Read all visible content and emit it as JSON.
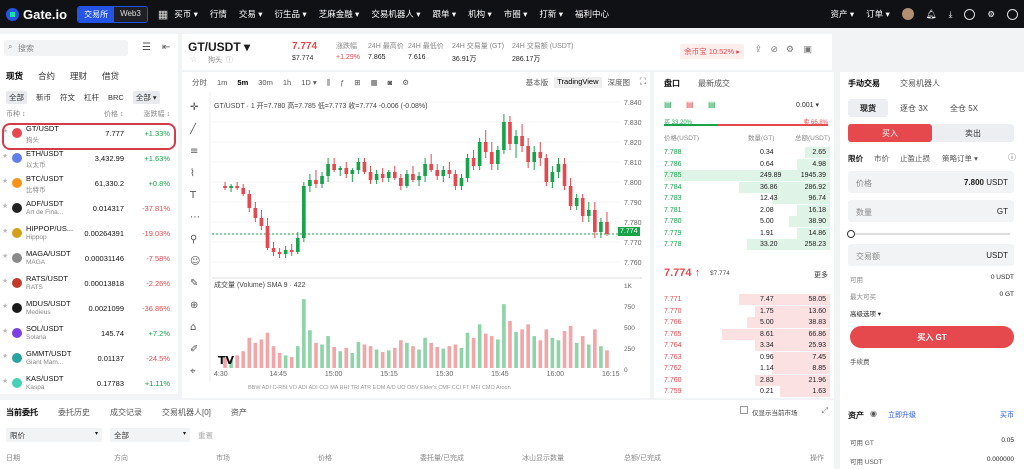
{
  "topbar": {
    "logo": "Gate.io",
    "mode_tabs": [
      "交易所",
      "Web3"
    ],
    "nav": [
      "买币 ▾",
      "行情",
      "交易 ▾",
      "衍生品 ▾",
      "芝麻金融 ▾",
      "交易机器人 ▾",
      "跟单 ▾",
      "机构 ▾",
      "市圈 ▾",
      "打新 ▾",
      "福利中心"
    ],
    "right": [
      "资产 ▾",
      "订单 ▾"
    ]
  },
  "left": {
    "search_placeholder": "搜索",
    "cats": [
      "现货",
      "合约",
      "理财",
      "借贷"
    ],
    "subcats": [
      "全部",
      "新币",
      "符文",
      "杠杆",
      "BRC",
      "全部 ▾"
    ],
    "col_pair": "币种 ↕",
    "col_price": "价格 ↕",
    "col_change": "涨跌幅 ↕",
    "rows": [
      {
        "pair": "GT/USDT",
        "sub": "狗头",
        "price": "7.777",
        "change": "+1.33%",
        "color": "#e5484d"
      },
      {
        "pair": "ETH/USDT",
        "sub": "以太币",
        "price": "3,432.99",
        "change": "+1.63%",
        "color": "#627eea"
      },
      {
        "pair": "BTC/USDT",
        "sub": "比特币",
        "price": "61,330.2",
        "change": "+0.8%",
        "color": "#f7931a"
      },
      {
        "pair": "ADF/USDT",
        "sub": "Art de Fina...",
        "price": "0.014317",
        "change": "-37.81%",
        "color": "#222222"
      },
      {
        "pair": "HIPPOP/US...",
        "sub": "Hippop",
        "price": "0.00264391",
        "change": "-19.03%",
        "color": "#d4a017"
      },
      {
        "pair": "MAGA/USDT",
        "sub": "MAGA",
        "price": "0.00031146",
        "change": "-7.58%",
        "color": "#8a8a8a"
      },
      {
        "pair": "RATS/USDT",
        "sub": "RATS",
        "price": "0.00013818",
        "change": "-2.26%",
        "color": "#c0392b"
      },
      {
        "pair": "MDUS/USDT",
        "sub": "Medieus",
        "price": "0.0021099",
        "change": "-36.86%",
        "color": "#1a1a1a"
      },
      {
        "pair": "SOL/USDT",
        "sub": "Solana",
        "price": "145.74",
        "change": "+7.2%",
        "color": "#7b3fe4"
      },
      {
        "pair": "GMMT/USDT",
        "sub": "Giant Mam...",
        "price": "0.01137",
        "change": "-24.5%",
        "color": "#2aa3a3"
      },
      {
        "pair": "KAS/USDT",
        "sub": "Kaspa",
        "price": "0.17783",
        "change": "+1.11%",
        "color": "#49d1b5"
      }
    ]
  },
  "header": {
    "pair": "GT/USDT ▾",
    "pair_sub": "狗头",
    "last_price": "7.774",
    "last_price_usd": "$7.774",
    "stats": [
      {
        "label": "涨跌幅",
        "value": "+1.29%"
      },
      {
        "label": "24H 最高价",
        "value": "7.865"
      },
      {
        "label": "24H 最低价",
        "value": "7.616"
      },
      {
        "label": "24H 交易量 (GT)",
        "value": "36.91万"
      },
      {
        "label": "24H 交易额 (USDT)",
        "value": "286.17万"
      }
    ],
    "yubi": "余币宝 10.52% ▸"
  },
  "chart": {
    "intervals": [
      "分时",
      "1m",
      "5m",
      "30m",
      "1h",
      "1D ▾"
    ],
    "views": [
      "基本版",
      "TradingView",
      "深度图"
    ],
    "ohlc": "GT/USDT · 1 开=7.780 高=7.785 低=7.773 收=7.774 -0.006 (-0.08%)",
    "volume_label": "成交量 (Volume) SMA 9 · 422",
    "price_tag": "7.774",
    "indicators": "BBW ADI C-RBI VO ADI ADI CCI MA RHI TRI ATR EOM A/D UO OBV Elder's CMF CCI FT MFI CMO Aroon",
    "chart_data": {
      "type": "candlestick",
      "title": "GT/USDT",
      "ylim": [
        7.755,
        7.845
      ],
      "yticks": [
        "7.840",
        "7.830",
        "7.820",
        "7.810",
        "7.800",
        "7.790",
        "7.780",
        "7.770",
        "7.760"
      ],
      "xticks": [
        "4:30",
        "14:45",
        "15:00",
        "15:15",
        "15:30",
        "15:45",
        "16:00",
        "16:15"
      ],
      "volume_ticks": [
        "1K",
        "750",
        "500",
        "250",
        "0"
      ],
      "volume_max": 1000,
      "candles": [
        {
          "o": 7.798,
          "h": 7.8,
          "l": 7.796,
          "c": 7.797,
          "v": 120
        },
        {
          "o": 7.797,
          "h": 7.799,
          "l": 7.795,
          "c": 7.798,
          "v": 90
        },
        {
          "o": 7.798,
          "h": 7.8,
          "l": 7.796,
          "c": 7.797,
          "v": 150
        },
        {
          "o": 7.797,
          "h": 7.799,
          "l": 7.793,
          "c": 7.794,
          "v": 200
        },
        {
          "o": 7.794,
          "h": 7.796,
          "l": 7.785,
          "c": 7.787,
          "v": 360
        },
        {
          "o": 7.787,
          "h": 7.79,
          "l": 7.78,
          "c": 7.782,
          "v": 300
        },
        {
          "o": 7.782,
          "h": 7.786,
          "l": 7.776,
          "c": 7.778,
          "v": 340
        },
        {
          "o": 7.778,
          "h": 7.782,
          "l": 7.766,
          "c": 7.767,
          "v": 420
        },
        {
          "o": 7.767,
          "h": 7.77,
          "l": 7.763,
          "c": 7.765,
          "v": 260
        },
        {
          "o": 7.765,
          "h": 7.767,
          "l": 7.762,
          "c": 7.764,
          "v": 180
        },
        {
          "o": 7.764,
          "h": 7.768,
          "l": 7.762,
          "c": 7.766,
          "v": 150
        },
        {
          "o": 7.766,
          "h": 7.769,
          "l": 7.763,
          "c": 7.765,
          "v": 130
        },
        {
          "o": 7.765,
          "h": 7.775,
          "l": 7.764,
          "c": 7.772,
          "v": 260
        },
        {
          "o": 7.772,
          "h": 7.8,
          "l": 7.77,
          "c": 7.798,
          "v": 820
        },
        {
          "o": 7.798,
          "h": 7.804,
          "l": 7.795,
          "c": 7.801,
          "v": 450
        },
        {
          "o": 7.801,
          "h": 7.806,
          "l": 7.797,
          "c": 7.799,
          "v": 300
        },
        {
          "o": 7.799,
          "h": 7.805,
          "l": 7.797,
          "c": 7.803,
          "v": 280
        },
        {
          "o": 7.803,
          "h": 7.812,
          "l": 7.8,
          "c": 7.809,
          "v": 380
        },
        {
          "o": 7.809,
          "h": 7.812,
          "l": 7.805,
          "c": 7.806,
          "v": 250
        },
        {
          "o": 7.806,
          "h": 7.808,
          "l": 7.803,
          "c": 7.807,
          "v": 200
        },
        {
          "o": 7.807,
          "h": 7.81,
          "l": 7.802,
          "c": 7.804,
          "v": 240
        },
        {
          "o": 7.804,
          "h": 7.807,
          "l": 7.8,
          "c": 7.806,
          "v": 180
        },
        {
          "o": 7.806,
          "h": 7.812,
          "l": 7.804,
          "c": 7.81,
          "v": 310
        },
        {
          "o": 7.81,
          "h": 7.812,
          "l": 7.804,
          "c": 7.805,
          "v": 280
        },
        {
          "o": 7.805,
          "h": 7.808,
          "l": 7.799,
          "c": 7.801,
          "v": 260
        },
        {
          "o": 7.801,
          "h": 7.806,
          "l": 7.799,
          "c": 7.804,
          "v": 220
        },
        {
          "o": 7.804,
          "h": 7.807,
          "l": 7.8,
          "c": 7.802,
          "v": 190
        },
        {
          "o": 7.802,
          "h": 7.806,
          "l": 7.8,
          "c": 7.805,
          "v": 210
        },
        {
          "o": 7.805,
          "h": 7.808,
          "l": 7.801,
          "c": 7.802,
          "v": 240
        },
        {
          "o": 7.802,
          "h": 7.804,
          "l": 7.796,
          "c": 7.798,
          "v": 330
        },
        {
          "o": 7.798,
          "h": 7.806,
          "l": 7.797,
          "c": 7.804,
          "v": 300
        },
        {
          "o": 7.804,
          "h": 7.808,
          "l": 7.8,
          "c": 7.801,
          "v": 260
        },
        {
          "o": 7.801,
          "h": 7.805,
          "l": 7.798,
          "c": 7.803,
          "v": 220
        },
        {
          "o": 7.803,
          "h": 7.812,
          "l": 7.8,
          "c": 7.809,
          "v": 360
        },
        {
          "o": 7.809,
          "h": 7.814,
          "l": 7.805,
          "c": 7.806,
          "v": 300
        },
        {
          "o": 7.806,
          "h": 7.809,
          "l": 7.801,
          "c": 7.803,
          "v": 250
        },
        {
          "o": 7.803,
          "h": 7.808,
          "l": 7.8,
          "c": 7.806,
          "v": 230
        },
        {
          "o": 7.806,
          "h": 7.81,
          "l": 7.802,
          "c": 7.804,
          "v": 260
        },
        {
          "o": 7.804,
          "h": 7.806,
          "l": 7.796,
          "c": 7.798,
          "v": 280
        },
        {
          "o": 7.798,
          "h": 7.804,
          "l": 7.796,
          "c": 7.802,
          "v": 240
        },
        {
          "o": 7.802,
          "h": 7.814,
          "l": 7.8,
          "c": 7.812,
          "v": 420
        },
        {
          "o": 7.812,
          "h": 7.816,
          "l": 7.806,
          "c": 7.808,
          "v": 360
        },
        {
          "o": 7.808,
          "h": 7.822,
          "l": 7.806,
          "c": 7.82,
          "v": 520
        },
        {
          "o": 7.82,
          "h": 7.826,
          "l": 7.812,
          "c": 7.815,
          "v": 410
        },
        {
          "o": 7.815,
          "h": 7.82,
          "l": 7.806,
          "c": 7.809,
          "v": 380
        },
        {
          "o": 7.809,
          "h": 7.818,
          "l": 7.806,
          "c": 7.816,
          "v": 340
        },
        {
          "o": 7.816,
          "h": 7.834,
          "l": 7.814,
          "c": 7.83,
          "v": 760
        },
        {
          "o": 7.83,
          "h": 7.833,
          "l": 7.816,
          "c": 7.819,
          "v": 560
        },
        {
          "o": 7.819,
          "h": 7.826,
          "l": 7.812,
          "c": 7.823,
          "v": 430
        },
        {
          "o": 7.823,
          "h": 7.829,
          "l": 7.815,
          "c": 7.818,
          "v": 460
        },
        {
          "o": 7.818,
          "h": 7.822,
          "l": 7.807,
          "c": 7.81,
          "v": 520
        },
        {
          "o": 7.81,
          "h": 7.818,
          "l": 7.806,
          "c": 7.815,
          "v": 380
        },
        {
          "o": 7.815,
          "h": 7.82,
          "l": 7.808,
          "c": 7.812,
          "v": 330
        },
        {
          "o": 7.812,
          "h": 7.814,
          "l": 7.798,
          "c": 7.8,
          "v": 460
        },
        {
          "o": 7.8,
          "h": 7.808,
          "l": 7.797,
          "c": 7.805,
          "v": 360
        },
        {
          "o": 7.805,
          "h": 7.812,
          "l": 7.802,
          "c": 7.809,
          "v": 330
        },
        {
          "o": 7.809,
          "h": 7.812,
          "l": 7.796,
          "c": 7.798,
          "v": 440
        },
        {
          "o": 7.798,
          "h": 7.802,
          "l": 7.786,
          "c": 7.788,
          "v": 500
        },
        {
          "o": 7.788,
          "h": 7.794,
          "l": 7.786,
          "c": 7.792,
          "v": 300
        },
        {
          "o": 7.792,
          "h": 7.794,
          "l": 7.78,
          "c": 7.783,
          "v": 380
        },
        {
          "o": 7.783,
          "h": 7.79,
          "l": 7.78,
          "c": 7.786,
          "v": 280
        },
        {
          "o": 7.786,
          "h": 7.79,
          "l": 7.772,
          "c": 7.775,
          "v": 460
        },
        {
          "o": 7.775,
          "h": 7.782,
          "l": 7.772,
          "c": 7.78,
          "v": 260
        },
        {
          "o": 7.78,
          "h": 7.785,
          "l": 7.773,
          "c": 7.774,
          "v": 210
        }
      ]
    }
  },
  "orderbook": {
    "tabs": [
      "盘口",
      "最新成交"
    ],
    "precision": "0.001 ▾",
    "ratio": "买 33.20%",
    "ratio_sell": "卖 66.8%",
    "cols": [
      "价格(USDT)",
      "数量(GT)",
      "总额(USDT)"
    ],
    "bids": [
      [
        "7.788",
        "0.34",
        "2.65",
        0.15
      ],
      [
        "7.786",
        "0.64",
        "4.98",
        0.2
      ],
      [
        "7.785",
        "249.89",
        "1945.39",
        1.0
      ],
      [
        "7.784",
        "36.86",
        "286.92",
        0.55
      ],
      [
        "7.783",
        "12.43",
        "96.74",
        0.35
      ],
      [
        "7.781",
        "2.08",
        "16.18",
        0.2
      ],
      [
        "7.780",
        "5.00",
        "38.90",
        0.25
      ],
      [
        "7.779",
        "1.91",
        "14.86",
        0.2
      ],
      [
        "7.778",
        "33.20",
        "258.23",
        0.5
      ]
    ],
    "mid_price": "7.774 ↑",
    "mid_usd": "$7.774",
    "more": "更多",
    "asks": [
      [
        "7.771",
        "7.47",
        "58.05",
        0.55
      ],
      [
        "7.770",
        "1.75",
        "13.60",
        0.45
      ],
      [
        "7.766",
        "5.00",
        "38.83",
        0.5
      ],
      [
        "7.765",
        "8.61",
        "66.86",
        0.65
      ],
      [
        "7.764",
        "3.34",
        "25.93",
        0.45
      ],
      [
        "7.763",
        "0.96",
        "7.45",
        0.35
      ],
      [
        "7.762",
        "1.14",
        "8.85",
        0.35
      ],
      [
        "7.760",
        "2.83",
        "21.96",
        0.45
      ],
      [
        "7.759",
        "0.21",
        "1.63",
        0.3
      ]
    ]
  },
  "trade": {
    "tabs": [
      "手动交易",
      "交易机器人"
    ],
    "types": [
      "现货",
      "逐仓 3X",
      "全仓 5X"
    ],
    "buy": "买入",
    "sell": "卖出",
    "order_types": [
      "限价",
      "市价",
      "止盈止损",
      "策略订单 ▾"
    ],
    "price_label": "价格",
    "price_value": "7.800",
    "price_unit": "USDT",
    "qty_label": "数量",
    "qty_unit": "GT",
    "amount_label": "交易额",
    "amount_unit": "USDT",
    "available_label": "可用",
    "available_value": "0 USDT",
    "maxbuy_label": "最大可买",
    "maxbuy_value": "0 GT",
    "advanced": "高级选项 ▾",
    "submit": "买入 GT",
    "fee": "手续费"
  },
  "bottom": {
    "tabs": [
      "当前委托",
      "委托历史",
      "成交记录",
      "交易机器人[0]",
      "资产"
    ],
    "filter1": "限价",
    "filter2": "全部",
    "reset": "重置",
    "only_current": "仅显示当前市场",
    "cols": [
      "日期",
      "方向",
      "市场",
      "价格",
      "委托量/已完成",
      "冰山显示数量",
      "总额/已完成",
      "操作"
    ]
  },
  "assets": {
    "title": "资产",
    "upgrade": "立即升级",
    "buy": "买币",
    "rows": [
      [
        "可用 GT",
        "0.05"
      ],
      [
        "可用 USDT",
        "0.000000"
      ]
    ]
  }
}
